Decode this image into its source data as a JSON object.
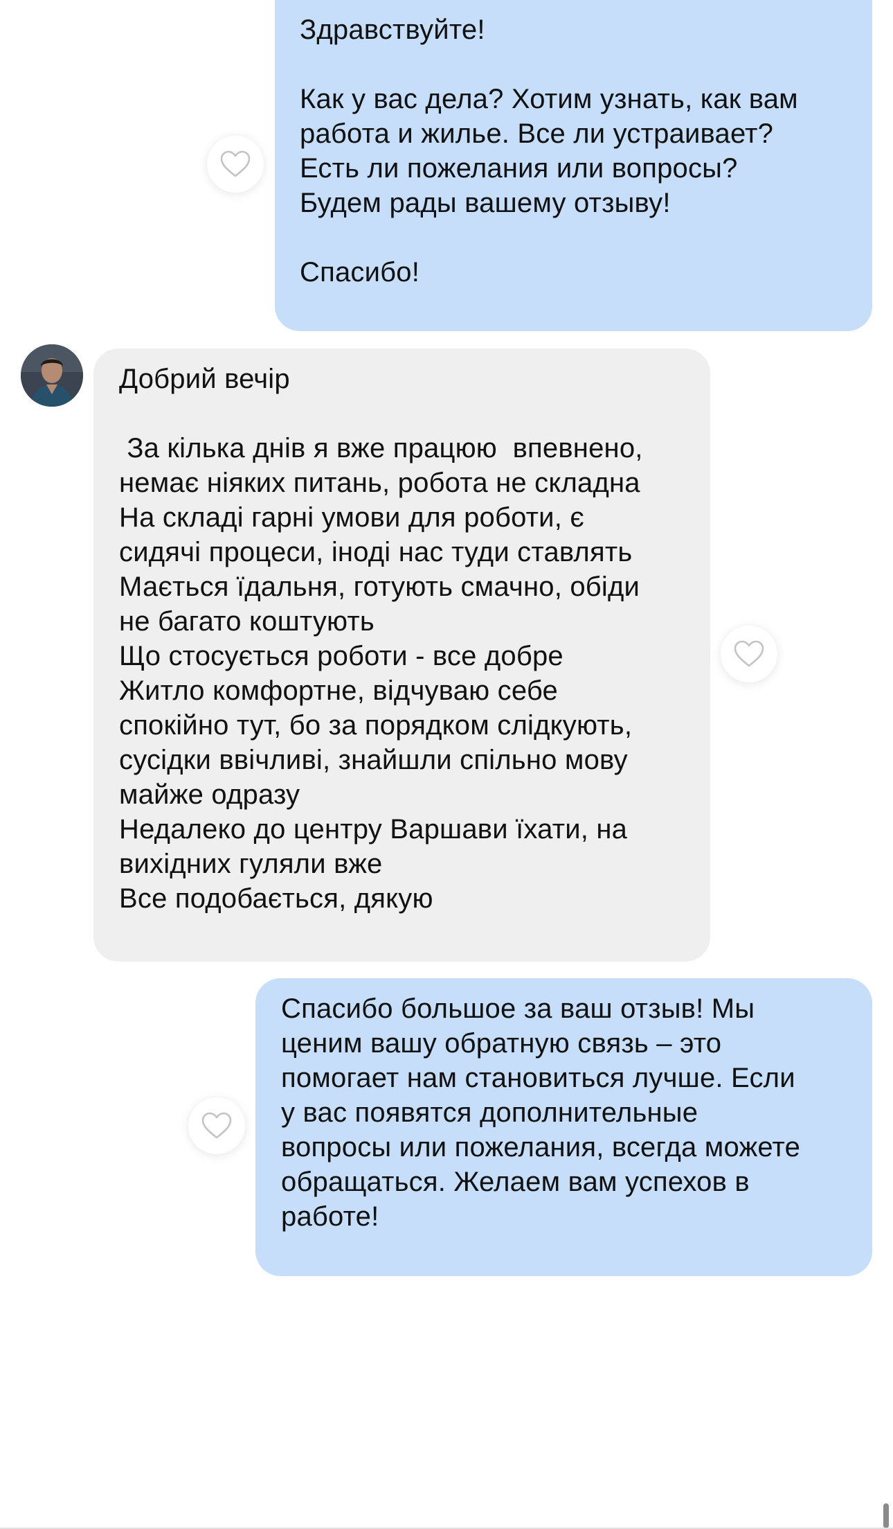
{
  "messages": [
    {
      "direction": "outgoing",
      "lines": [
        "Здравствуйте!",
        "",
        "Как у вас дела? Хотим узнать, как вам",
        "работа и жилье. Все ли устраивает?",
        "Есть ли пожелания или вопросы?",
        "Будем рады вашему отзыву!",
        "",
        "Спасибо!"
      ]
    },
    {
      "direction": "incoming",
      "lines": [
        "Добрий вечір",
        "",
        " За кілька днів я вже працюю  впевнено,",
        "немає ніяких питань, робота не складна",
        "На складі гарні умови для роботи, є",
        "сидячі процеси, іноді нас туди ставлять",
        "Мається їдальня, готують смачно, обіди",
        "не багато коштують",
        "Що стосується роботи - все добре",
        "Житло комфортне, відчуваю себе",
        "спокійно тут, бо за порядком слідкують,",
        "сусідки ввічливі, знайшли спільно мову",
        "майже одразу",
        "Недалеко до центру Варшави їхати, на",
        "вихідних гуляли вже",
        "Все подобається, дякую"
      ]
    },
    {
      "direction": "outgoing",
      "lines": [
        "Спасибо большое за ваш отзыв! Мы",
        "ценим вашу обратную связь – это",
        "помогает нам становиться лучше. Если",
        "у вас появятся дополнительные",
        "вопросы или пожелания, всегда можете",
        "обращаться. Желаем вам успехов в",
        "работе!"
      ]
    }
  ],
  "icons": {
    "like": "heart-outline-icon",
    "avatar": "contact-avatar"
  },
  "colors": {
    "outgoing_bubble": "#c6defa",
    "incoming_bubble": "#efefef",
    "heart_stroke": "#c4c4c4"
  }
}
